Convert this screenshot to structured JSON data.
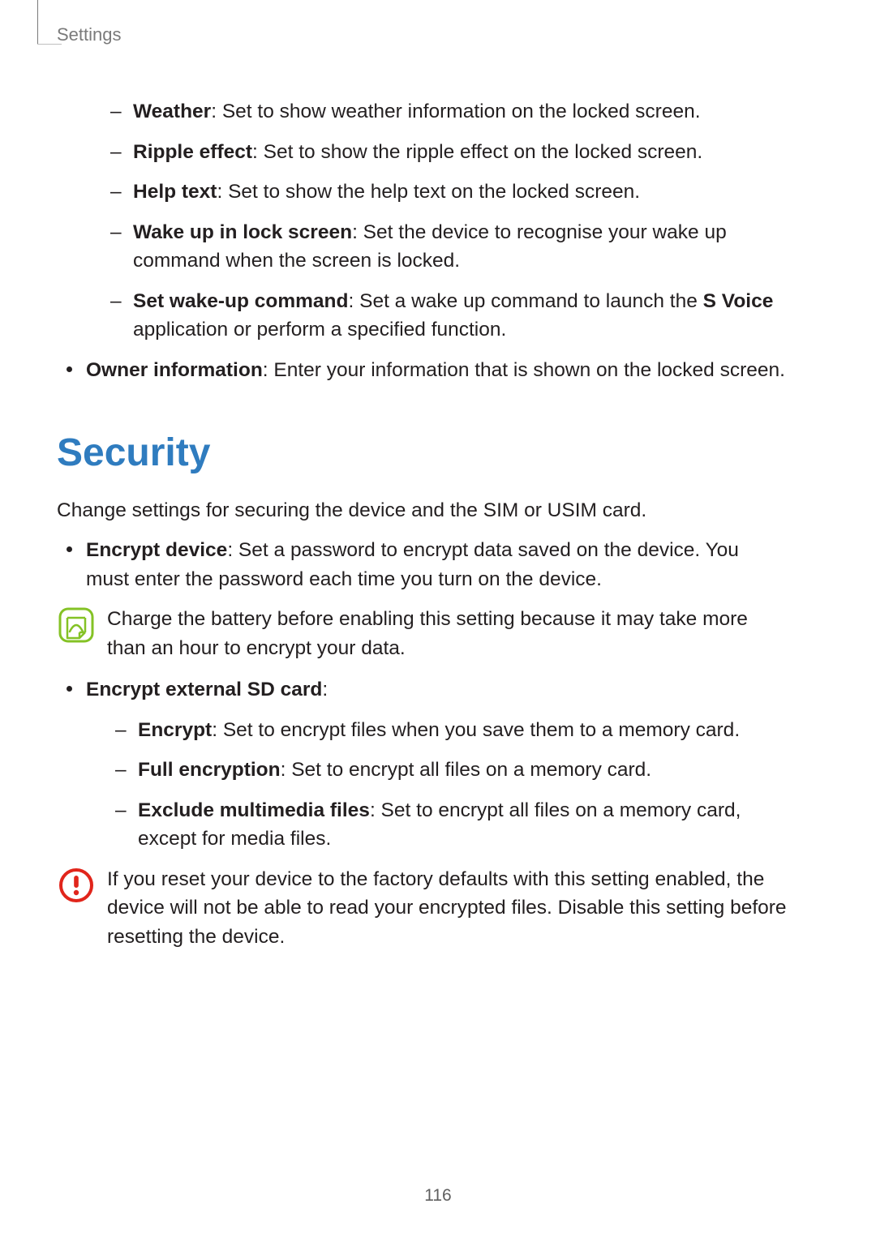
{
  "header": {
    "breadcrumb": "Settings"
  },
  "lock_screen": {
    "items": [
      {
        "title": "Weather",
        "desc": ": Set to show weather information on the locked screen."
      },
      {
        "title": "Ripple effect",
        "desc": ": Set to show the ripple effect on the locked screen."
      },
      {
        "title": "Help text",
        "desc": ": Set to show the help text on the locked screen."
      },
      {
        "title": "Wake up in lock screen",
        "desc": ": Set the device to recognise your wake up command when the screen is locked."
      },
      {
        "title": "Set wake-up command",
        "desc_pre": ": Set a wake up command to launch the ",
        "app": "S Voice",
        "desc_post": " application or perform a specified function."
      }
    ],
    "owner_info": {
      "title": "Owner information",
      "desc": ": Enter your information that is shown on the locked screen."
    }
  },
  "security": {
    "heading": "Security",
    "intro": "Change settings for securing the device and the SIM or USIM card.",
    "encrypt_device": {
      "title": "Encrypt device",
      "desc": ": Set a password to encrypt data saved on the device. You must enter the password each time you turn on the device."
    },
    "note_charge": "Charge the battery before enabling this setting because it may take more than an hour to encrypt your data.",
    "encrypt_sd": {
      "title": "Encrypt external SD card",
      "colon": ":",
      "items": [
        {
          "title": "Encrypt",
          "desc": ": Set to encrypt files when you save them to a memory card."
        },
        {
          "title": "Full encryption",
          "desc": ": Set to encrypt all files on a memory card."
        },
        {
          "title": "Exclude multimedia files",
          "desc": ": Set to encrypt all files on a memory card, except for media files."
        }
      ]
    },
    "warning_reset": "If you reset your device to the factory defaults with this setting enabled, the device will not be able to read your encrypted files. Disable this setting before resetting the device."
  },
  "page_number": "116"
}
